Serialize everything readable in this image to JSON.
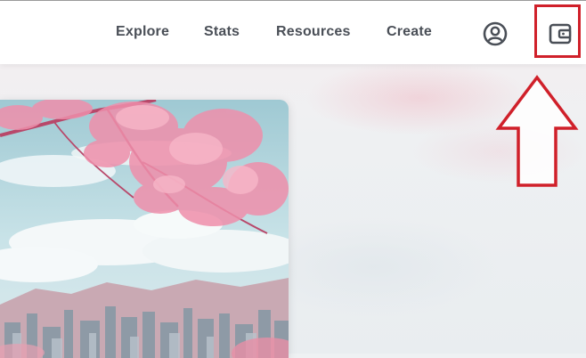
{
  "navbar": {
    "links": [
      "Explore",
      "Stats",
      "Resources",
      "Create"
    ],
    "profile_icon": "account-circle-icon",
    "wallet_icon": "wallet-icon"
  },
  "annotation": {
    "color": "#d0202a",
    "target": "wallet-icon"
  },
  "hero": {
    "description_icon": "landscape-image"
  }
}
